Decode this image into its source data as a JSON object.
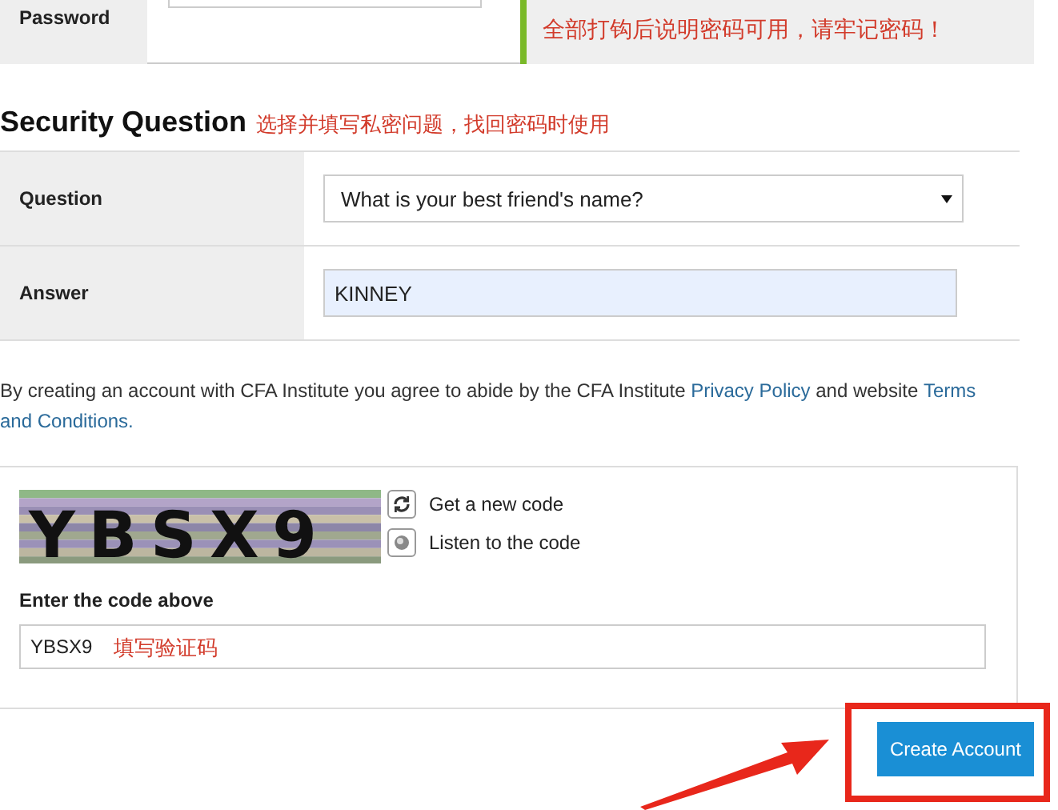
{
  "password_row": {
    "label": "Password",
    "note": "全部打钩后说明密码可用，请牢记密码！"
  },
  "security_question": {
    "heading": "Security Question",
    "note": "选择并填写私密问题，找回密码时使用",
    "rows": [
      {
        "kind": "select",
        "label": "Question",
        "value": "What is your best friend's name?"
      },
      {
        "kind": "input",
        "label": "Answer",
        "value": "KINNEY"
      }
    ]
  },
  "agreement": [
    {
      "kind": "text",
      "text": "By creating an account with CFA Institute you agree to abide by the CFA Institute "
    },
    {
      "kind": "link",
      "text": "Privacy Policy"
    },
    {
      "kind": "text",
      "text": " and website "
    },
    {
      "kind": "link",
      "text": "Terms"
    },
    {
      "kind": "link",
      "text": "and Conditions."
    }
  ],
  "captcha": {
    "code_image_text": "YBSX9",
    "actions": [
      "Get a new code",
      "Listen to the code"
    ],
    "label": "Enter the code above",
    "value": "YBSX9",
    "note": "填写验证码"
  },
  "button": "Create Account"
}
